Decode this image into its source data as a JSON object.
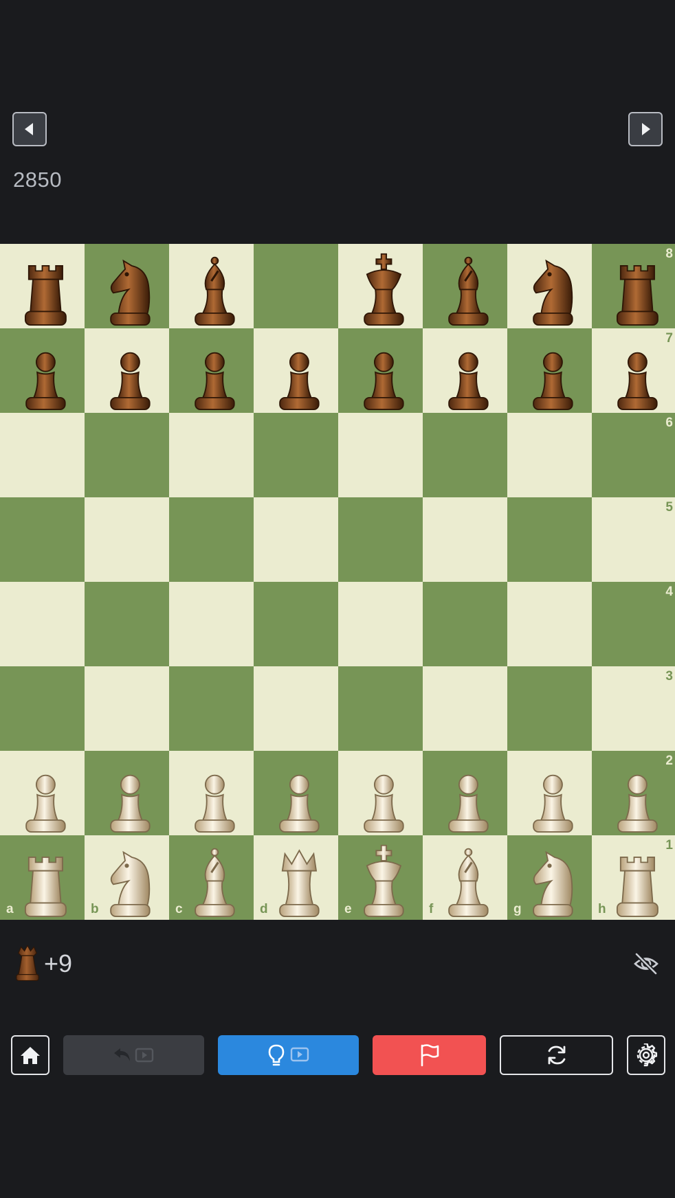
{
  "header": {
    "prev_icon": "caret-left-icon",
    "next_icon": "caret-right-icon",
    "opponent_rating": "2850"
  },
  "board": {
    "light_color": "#ebecd0",
    "dark_color": "#779556",
    "ranks": [
      "8",
      "7",
      "6",
      "5",
      "4",
      "3",
      "2",
      "1"
    ],
    "files": [
      "a",
      "b",
      "c",
      "d",
      "e",
      "f",
      "g",
      "h"
    ],
    "position": [
      [
        "bR",
        "bN",
        "bB",
        "",
        "bK",
        "bB",
        "bN",
        "bR"
      ],
      [
        "bP",
        "bP",
        "bP",
        "bP",
        "bP",
        "bP",
        "bP",
        "bP"
      ],
      [
        "",
        "",
        "",
        "",
        "",
        "",
        "",
        ""
      ],
      [
        "",
        "",
        "",
        "",
        "",
        "",
        "",
        ""
      ],
      [
        "",
        "",
        "",
        "",
        "",
        "",
        "",
        ""
      ],
      [
        "",
        "",
        "",
        "",
        "",
        "",
        "",
        ""
      ],
      [
        "wP",
        "wP",
        "wP",
        "wP",
        "wP",
        "wP",
        "wP",
        "wP"
      ],
      [
        "wR",
        "wN",
        "wB",
        "wQ",
        "wK",
        "wB",
        "wN",
        "wR"
      ]
    ]
  },
  "material": {
    "icon": "black-queen-icon",
    "advantage": "+9"
  },
  "toolbar": {
    "home_icon": "home-icon",
    "undo_icon": "undo-icon",
    "hint_icon": "lightbulb-icon",
    "resign_icon": "flag-icon",
    "flip_icon": "refresh-icon",
    "settings_icon": "gear-icon",
    "hide_icon": "eye-slash-icon",
    "hint_color": "#2b88de",
    "resign_color": "#f25252",
    "undo_color": "#3b3d42"
  }
}
